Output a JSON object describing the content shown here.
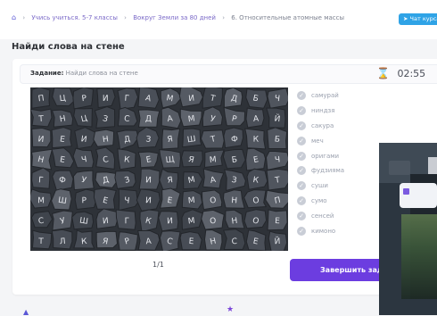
{
  "breadcrumb": {
    "home_icon": "home-icon",
    "items": [
      "Учись учиться. 5-7 классы",
      "Вокруг Земли за 80 дней",
      "6. Относительные атомные массы"
    ]
  },
  "telegram_button": {
    "label": "Чат курса",
    "color": "#2fa3e6"
  },
  "page_title": "Найди слова на стене",
  "task": {
    "label": "Задание:",
    "text": "Найди слова на стене"
  },
  "timer": {
    "icon": "hourglass-icon",
    "value": "02:55"
  },
  "words": [
    {
      "text": "самурай"
    },
    {
      "text": "ниндзя"
    },
    {
      "text": "сакура"
    },
    {
      "text": "меч"
    },
    {
      "text": "оригами"
    },
    {
      "text": "фудзияма"
    },
    {
      "text": "суши"
    },
    {
      "text": "сумо"
    },
    {
      "text": "сенсей"
    },
    {
      "text": "кимоно"
    }
  ],
  "board_letters": [
    "П",
    "Ц",
    "Р",
    "И",
    "Г",
    "А",
    "М",
    "И",
    "Т",
    "Д",
    "Б",
    "Ч",
    "Т",
    "Н",
    "Ц",
    "З",
    "С",
    "Д",
    "А",
    "М",
    "У",
    "Р",
    "А",
    "Й",
    "И",
    "Е",
    "И",
    "Н",
    "Д",
    "З",
    "Я",
    "Ш",
    "Т",
    "Ф",
    "К",
    "Б",
    "Н",
    "Е",
    "Ч",
    "С",
    "К",
    "Е",
    "Щ",
    "Я",
    "М",
    "Б",
    "Е",
    "Ч",
    "Г",
    "Ф",
    "У",
    "Д",
    "З",
    "И",
    "Я",
    "М",
    "А",
    "З",
    "К",
    "Т",
    "М",
    "Ш",
    "Р",
    "Е",
    "Ч",
    "И",
    "Е",
    "М",
    "О",
    "Н",
    "О",
    "П",
    "С",
    "У",
    "Ш",
    "И",
    "Г",
    "К",
    "И",
    "М",
    "О",
    "Н",
    "О",
    "Е",
    "Т",
    "Л",
    "К",
    "Я",
    "Р",
    "А",
    "С",
    "Е",
    "Н",
    "С",
    "Е",
    "Й"
  ],
  "pager": "1/1",
  "finish_button": "Завершить задание",
  "colors": {
    "accent": "#6c3de0",
    "link": "#7b6ac8",
    "board": "#3b3f46"
  }
}
